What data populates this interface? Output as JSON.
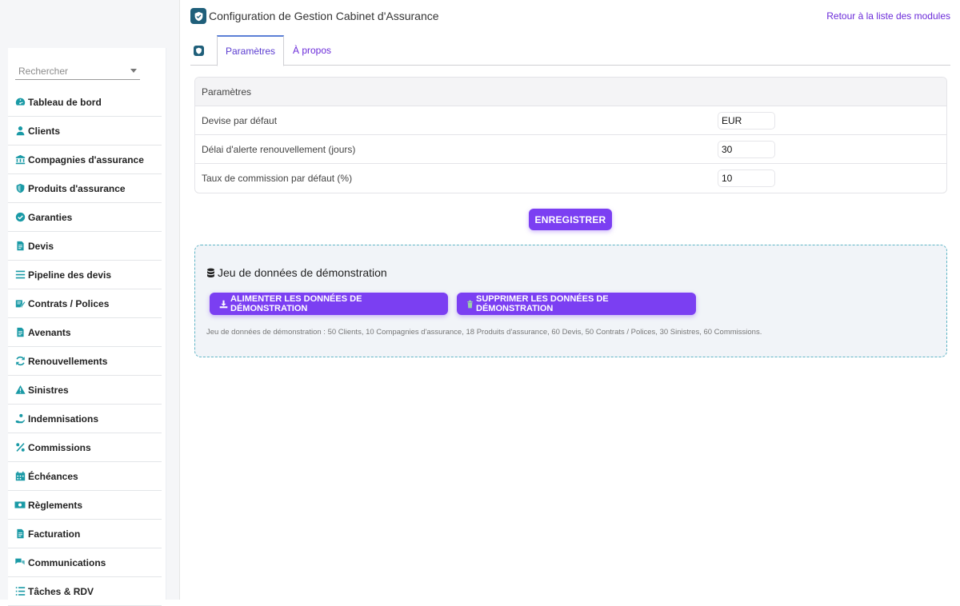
{
  "header": {
    "title": "Configuration de Gestion Cabinet d'Assurance",
    "back_link": "Retour à la liste des modules"
  },
  "sidebar": {
    "search_placeholder": "Rechercher",
    "items": [
      {
        "label": "Tableau de bord",
        "icon": "dashboard-icon"
      },
      {
        "label": "Clients",
        "icon": "user-icon"
      },
      {
        "label": "Compagnies d'assurance",
        "icon": "bank-icon"
      },
      {
        "label": "Produits d'assurance",
        "icon": "shield-icon"
      },
      {
        "label": "Garanties",
        "icon": "check-circle-icon"
      },
      {
        "label": "Devis",
        "icon": "document-icon"
      },
      {
        "label": "Pipeline des devis",
        "icon": "bars-icon"
      },
      {
        "label": "Contrats / Polices",
        "icon": "contract-edit-icon"
      },
      {
        "label": "Avenants",
        "icon": "document-icon"
      },
      {
        "label": "Renouvellements",
        "icon": "refresh-icon"
      },
      {
        "label": "Sinistres",
        "icon": "warning-icon"
      },
      {
        "label": "Indemnisations",
        "icon": "hand-coin-icon"
      },
      {
        "label": "Commissions",
        "icon": "percent-icon"
      },
      {
        "label": "Échéances",
        "icon": "calendar-icon"
      },
      {
        "label": "Règlements",
        "icon": "money-icon"
      },
      {
        "label": "Facturation",
        "icon": "invoice-icon"
      },
      {
        "label": "Communications",
        "icon": "chat-icon"
      },
      {
        "label": "Tâches & RDV",
        "icon": "tasks-icon"
      }
    ]
  },
  "tabs": {
    "params": "Paramètres",
    "about": "À propos"
  },
  "params": {
    "header": "Paramètres",
    "rows": [
      {
        "label": "Devise par défaut",
        "value": "EUR"
      },
      {
        "label": "Délai d'alerte renouvellement (jours)",
        "value": "30"
      },
      {
        "label": "Taux de commission par défaut (%)",
        "value": "10"
      }
    ],
    "save_label": "ENREGISTRER"
  },
  "demo": {
    "title": "Jeu de données de démonstration",
    "load_label": "ALIMENTER LES DONNÉES DE DÉMONSTRATION",
    "delete_label": "SUPPRIMER LES DONNÉES DE DÉMONSTRATION",
    "note": "Jeu de données de démonstration : 50 Clients, 10 Compagnies d'assurance, 18 Produits d'assurance, 60 Devis, 50 Contrats / Polices, 30 Sinistres, 60 Commissions."
  },
  "colors": {
    "accent": "#7b3ff2",
    "icon": "#1a9aa6",
    "logo": "#1f5f7a"
  }
}
